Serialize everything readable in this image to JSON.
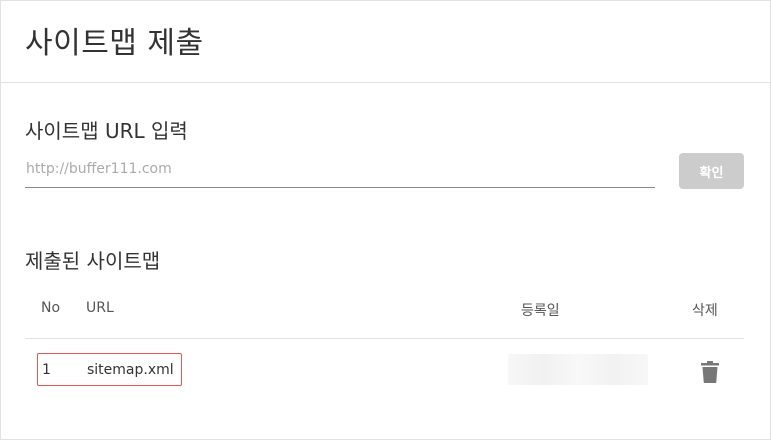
{
  "header": {
    "title": "사이트맵 제출"
  },
  "submit": {
    "section_title": "사이트맵 URL 입력",
    "input_placeholder": "http://buffer111.com",
    "input_value": "",
    "confirm_label": "확인"
  },
  "submitted": {
    "section_title": "제출된 사이트맵",
    "columns": {
      "no": "No",
      "url": "URL",
      "date": "등록일",
      "delete": "삭제"
    },
    "rows": [
      {
        "no": "1",
        "url": "sitemap.xml",
        "date": ""
      }
    ]
  },
  "icons": {
    "delete": "trash-icon"
  },
  "colors": {
    "button_disabled": "#cccccc",
    "row_highlight_border": "#e05a5a",
    "divider": "#e2e2e2"
  }
}
